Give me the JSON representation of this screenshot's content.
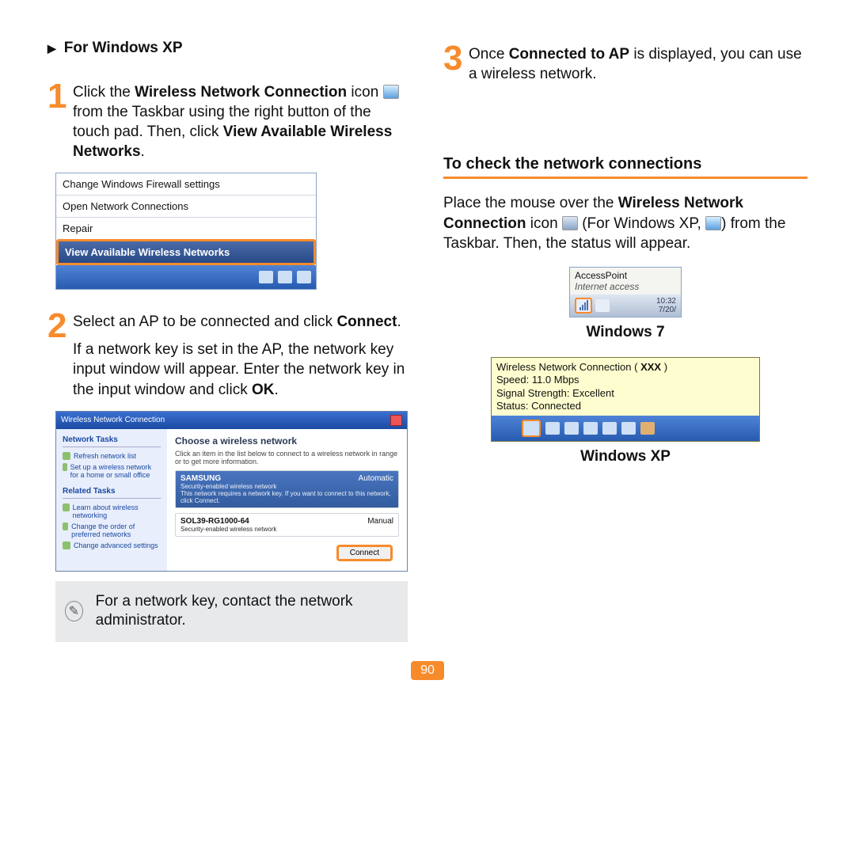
{
  "left": {
    "section_title": "For Windows XP",
    "step1": {
      "p1a": "Click the ",
      "bold1": "Wireless Network Connection",
      "p1b": " icon ",
      "p1c": " from the Taskbar using the right button of the touch pad. Then, click ",
      "bold2": "View Available Wireless Networks",
      "p1d": "."
    },
    "context_menu": {
      "item1": "Change Windows Firewall settings",
      "item2": "Open Network Connections",
      "item3": "Repair",
      "item4": "View Available Wireless Networks"
    },
    "step2": {
      "p1a": "Select an AP to be connected and click ",
      "bold1": "Connect",
      "p1b": ".",
      "p2a": "If a network key is set in the AP, the network key input window will appear. Enter the network key in the input window and click ",
      "bold2": "OK",
      "p2b": "."
    },
    "dialog": {
      "title": "Wireless Network Connection",
      "side_h1": "Network Tasks",
      "side_i1": "Refresh network list",
      "side_i2": "Set up a wireless network for a home or small office",
      "side_h2": "Related Tasks",
      "side_i3": "Learn about wireless networking",
      "side_i4": "Change the order of preferred networks",
      "side_i5": "Change advanced settings",
      "main_h": "Choose a wireless network",
      "main_desc": "Click an item in the list below to connect to a wireless network in range or to get more information.",
      "ap1_name": "SAMSUNG",
      "ap1_mode": "Automatic",
      "ap1_sec": "Security-enabled wireless network",
      "ap1_msg": "This network requires a network key. If you want to connect to this network, click Connect.",
      "ap2_name": "SOL39-RG1000-64",
      "ap2_mode": "Manual",
      "ap2_sec": "Security-enabled wireless network",
      "connect": "Connect"
    },
    "note": "For a network key, contact the network administrator."
  },
  "right": {
    "step3": {
      "p1a": "Once ",
      "bold1": "Connected to AP",
      "p1b": " is displayed, you can use a wireless network."
    },
    "h2": "To check the network connections",
    "para": {
      "a": "Place the mouse over the ",
      "b1": "Wireless Network Connection",
      "b": " icon ",
      "c": " (For Windows XP, ",
      "d": ") from the Taskbar. Then, the status will appear."
    },
    "win7": {
      "ssid": "AccessPoint",
      "status": "Internet access",
      "time": "10:32",
      "date": "7/20/"
    },
    "caption1": "Windows 7",
    "xp": {
      "line1a": "Wireless Network Connection (  ",
      "line1b": "XXX",
      "line1c": "  )",
      "line2": "Speed: 11.0 Mbps",
      "line3": "Signal Strength: Excellent",
      "line4": "Status: Connected"
    },
    "caption2": "Windows XP"
  },
  "page_number": "90"
}
